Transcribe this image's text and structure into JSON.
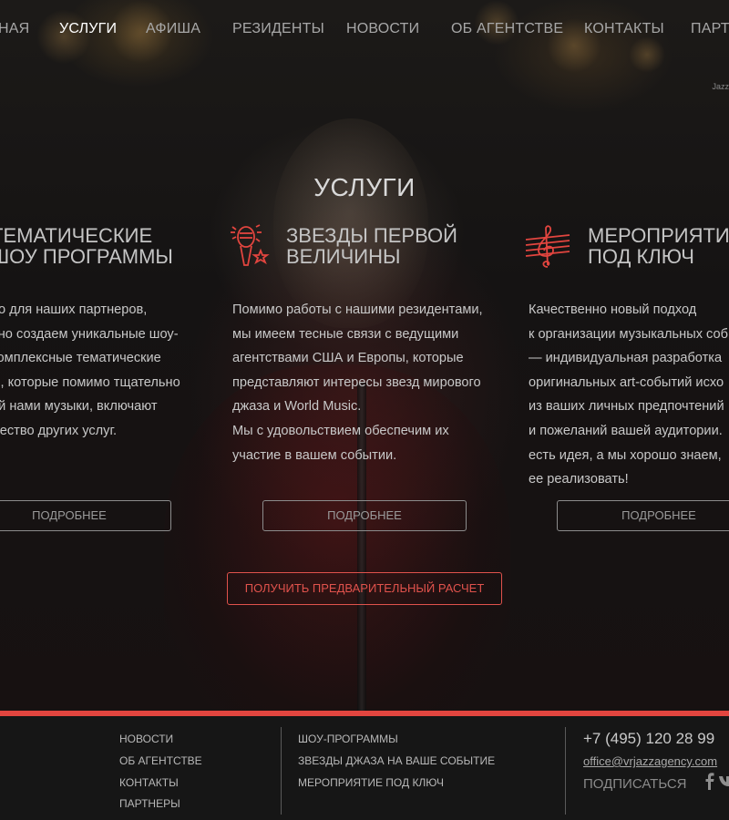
{
  "nav": {
    "items": [
      {
        "label": "НАЯ"
      },
      {
        "label": "УСЛУГИ"
      },
      {
        "label": "АФИША"
      },
      {
        "label": "РЕЗИДЕНТЫ"
      },
      {
        "label": "НОВОСТИ"
      },
      {
        "label": "ОБ АГЕНТСТВЕ"
      },
      {
        "label": "КОНТАКТЫ"
      },
      {
        "label": "ПАРТН"
      }
    ],
    "active_label": "УСЛУГИ"
  },
  "tagline": "Jazz",
  "section": {
    "title": "УСЛУГИ"
  },
  "services": [
    {
      "icon": "show-program-icon",
      "title_lines": [
        "ТЕМАТИЧЕСКИЕ",
        "ШОУ ПРОГРАММЫ"
      ],
      "text_lines": [
        "но для наших партнеров,",
        "вно создаем уникальные шоу-",
        "комплексные тематические",
        "ы, которые помимо тщательно",
        "ой нами музыки, включают",
        "жество других услуг."
      ],
      "button": "ПОДРОБНЕЕ"
    },
    {
      "icon": "microphone-icon",
      "title_lines": [
        "ЗВЕЗДЫ ПЕРВОЙ",
        "ВЕЛИЧИНЫ"
      ],
      "text_lines": [
        "Помимо работы с нашими резидентами,",
        "мы имеем тесные связи с ведущими",
        "агентствами США и Европы, которые",
        "представляют интересы звезд мирового",
        "джаза и  World Music.",
        "Мы с удовольствием обеспечим их",
        "участие в вашем событии."
      ],
      "button": "ПОДРОБНЕЕ"
    },
    {
      "icon": "treble-clef-icon",
      "title_lines": [
        "МЕРОПРИЯТИ",
        "ПОД КЛЮЧ"
      ],
      "text_lines": [
        "Качественно новый подход",
        "к организации музыкальных соб",
        "— индивидуальная разработка",
        "оригинальных art-событий исхо",
        "из ваших личных предпочтений",
        "и пожеланий вашей аудитории.",
        "есть идея, а мы хорошо знаем,",
        "ее реализовать!"
      ],
      "button": "ПОДРОБНЕЕ"
    }
  ],
  "cta": "ПОЛУЧИТЬ ПРЕДВАРИТЕЛЬНЫЙ РАСЧЕТ",
  "footer": {
    "col1": [
      "НОВОСТИ",
      "ОБ АГЕНТСТВЕ",
      "КОНТАКТЫ",
      "ПАРТНЕРЫ"
    ],
    "col2": [
      "ШОУ-ПРОГРАММЫ",
      "ЗВЕЗДЫ ДЖАЗА НА ВАШЕ СОБЫТИЕ",
      "МЕРОПРИЯТИЕ ПОД КЛЮЧ"
    ],
    "phone": "+7 (495) 120 28 99",
    "email": "office@vrjazzagency.com",
    "subscribe": "ПОДПИСАТЬСЯ",
    "social_icons": [
      "facebook-icon",
      "vk-icon"
    ]
  },
  "colors": {
    "accent": "#e2453f",
    "background": "#141414",
    "text": "#c8c8c8"
  }
}
